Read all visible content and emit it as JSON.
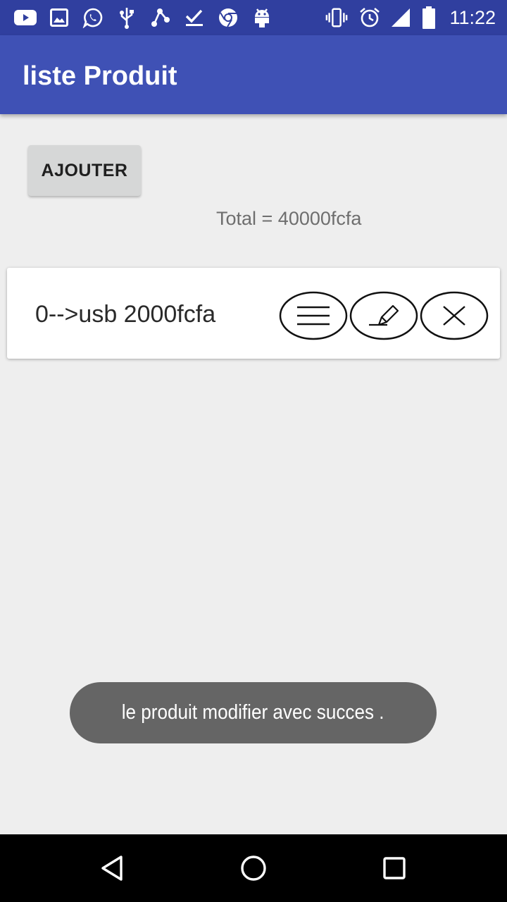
{
  "status_bar": {
    "time": "11:22",
    "notification_icons": [
      "youtube-icon",
      "image-icon",
      "whatsapp-icon",
      "usb-icon",
      "share-icon",
      "check-icon",
      "chrome-icon",
      "android-icon"
    ],
    "system_icons": [
      "vibrate-icon",
      "alarm-icon",
      "signal-icon",
      "battery-icon"
    ]
  },
  "app_bar": {
    "title": "liste Produit",
    "color": "#3F51B5",
    "status_color": "#303F9F"
  },
  "main": {
    "add_button_label": "AJOUTER",
    "total_text": "Total = 40000fcfa",
    "products": [
      {
        "label": "0-->usb 2000fcfa",
        "actions": [
          "details-icon",
          "edit-icon",
          "delete-icon"
        ]
      }
    ]
  },
  "toast": {
    "message": "le produit modifier avec succes ."
  },
  "nav_bar": {
    "buttons": [
      "back-icon",
      "home-icon",
      "recents-icon"
    ]
  }
}
